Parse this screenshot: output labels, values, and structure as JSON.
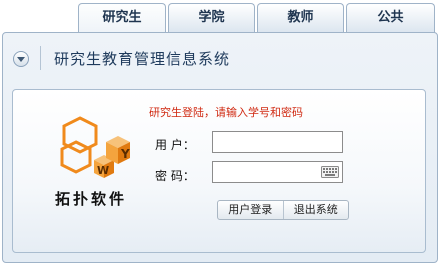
{
  "tabs": [
    {
      "label": "研究生",
      "active": true
    },
    {
      "label": "学院",
      "active": false
    },
    {
      "label": "教师",
      "active": false
    },
    {
      "label": "公共",
      "active": false
    }
  ],
  "header": {
    "title": "研究生教育管理信息系统",
    "collapse_icon": "chevron-down-icon"
  },
  "login": {
    "message": "研究生登陆，请输入学号和密码",
    "username_label": "用  户：",
    "password_label": "密  码：",
    "username_value": "",
    "password_value": "",
    "login_button": "用户登录",
    "exit_button": "退出系统",
    "keyboard_icon": "keyboard-icon"
  },
  "brand": {
    "name": "拓扑软件",
    "logo_letters": [
      "W",
      "Y"
    ]
  },
  "colors": {
    "accent": "#1e3a5c",
    "message": "#d02a12",
    "logo_orange": "#f08a1c"
  }
}
